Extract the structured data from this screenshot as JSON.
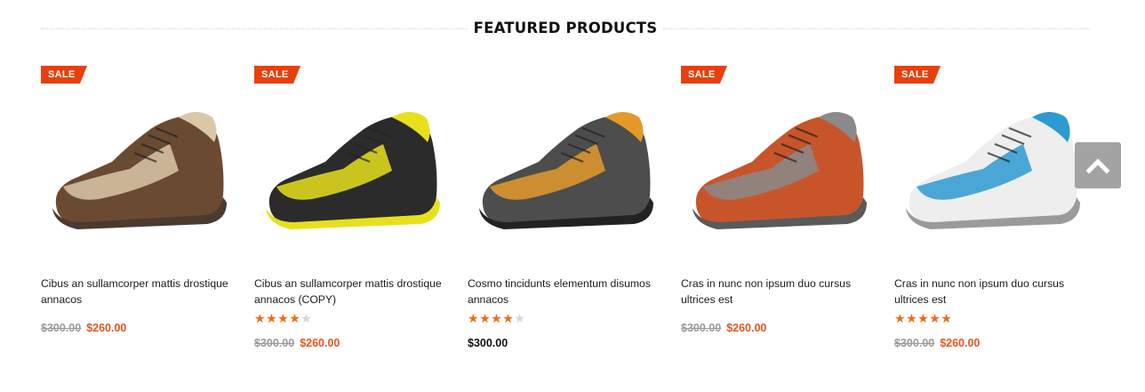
{
  "section": {
    "title": "FEATURED PRODUCTS"
  },
  "products": [
    {
      "badge": "SALE",
      "name": "Cibus an sullamcorper mattis drostique annacos",
      "rating": null,
      "old_price": "$300.00",
      "price": "$260.00",
      "shoe_colors": {
        "upper": "#6b4a32",
        "accent": "#d9c7a8",
        "sole": "#4a3b30"
      }
    },
    {
      "badge": "SALE",
      "name": "Cibus an sullamcorper mattis drostique annacos (COPY)",
      "rating": 4,
      "old_price": "$300.00",
      "price": "$260.00",
      "shoe_colors": {
        "upper": "#2b2b2b",
        "accent": "#e6e01c",
        "sole": "#e6e01c"
      }
    },
    {
      "badge": "",
      "name": "Cosmo tincidunts elementum disumos annacos",
      "rating": 4,
      "old_price": "",
      "price": "$300.00",
      "shoe_colors": {
        "upper": "#4d4d4d",
        "accent": "#e39a2b",
        "sole": "#222222"
      }
    },
    {
      "badge": "SALE",
      "name": "Cras in nunc non ipsum duo cursus ultrices est",
      "rating": null,
      "old_price": "$300.00",
      "price": "$260.00",
      "shoe_colors": {
        "upper": "#c8552a",
        "accent": "#8a8a8a",
        "sole": "#5a5a5a"
      }
    },
    {
      "badge": "SALE",
      "name": "Cras in nunc non ipsum duo cursus ultrices est",
      "rating": 5,
      "old_price": "$300.00",
      "price": "$260.00",
      "shoe_colors": {
        "upper": "#eeeeee",
        "accent": "#2d9ad0",
        "sole": "#9a9a9a"
      }
    }
  ],
  "scroll_top": {
    "icon": "chevron-up-icon"
  },
  "colors": {
    "sale_badge": "#e8400c",
    "price_sale": "#e8531e",
    "star": "#ee6a14",
    "star_empty": "#d6d6d6"
  }
}
